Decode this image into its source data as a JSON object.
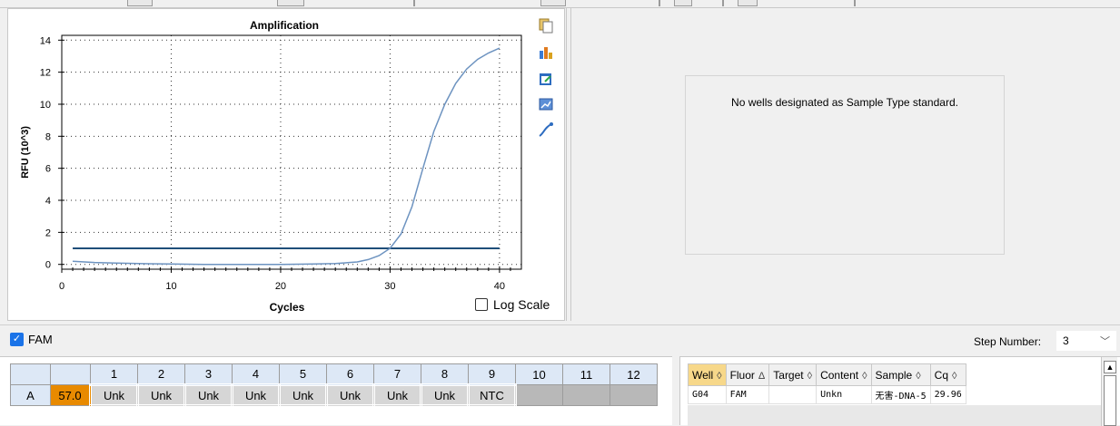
{
  "chart_data": {
    "type": "line",
    "title": "Amplification",
    "xlabel": "Cycles",
    "ylabel": "RFU (10^3)",
    "xlim": [
      0,
      42
    ],
    "ylim": [
      -0.3,
      14.3
    ],
    "xticks": [
      0,
      10,
      20,
      30,
      40
    ],
    "yticks": [
      0,
      2,
      4,
      6,
      8,
      10,
      12,
      14
    ],
    "grid": "dotted",
    "series": [
      {
        "color": "#6d93c0",
        "x": [
          1,
          3,
          5,
          8,
          10,
          13,
          15,
          18,
          20,
          23,
          25,
          27,
          28,
          29,
          30,
          31,
          32,
          33,
          34,
          35,
          36,
          37,
          38,
          39,
          40
        ],
        "y": [
          0.2,
          0.12,
          0.08,
          0.04,
          0.02,
          0.0,
          0.0,
          0.0,
          0.0,
          0.02,
          0.05,
          0.15,
          0.3,
          0.55,
          1.0,
          1.9,
          3.6,
          6.0,
          8.3,
          10.0,
          11.3,
          12.2,
          12.8,
          13.2,
          13.5
        ]
      }
    ],
    "threshold": {
      "y": 1.0,
      "color": "#1f4e79"
    },
    "log_scale_label": "Log Scale",
    "log_scale_checked": false
  },
  "tool_icons": [
    "copy-icon",
    "chart-settings-icon",
    "export-icon",
    "zoom-icon",
    "curve-icon"
  ],
  "standard_curve": {
    "message": "No wells designated as Sample Type standard."
  },
  "fluor": {
    "label": "FAM",
    "checked": true,
    "step_label": "Step Number:",
    "step_value": "3"
  },
  "plate": {
    "columns": [
      "1",
      "2",
      "3",
      "4",
      "5",
      "6",
      "7",
      "8",
      "9",
      "10",
      "11",
      "12"
    ],
    "rows": [
      {
        "label": "A",
        "temp": "57.0",
        "wells": [
          "Unk",
          "Unk",
          "Unk",
          "Unk",
          "Unk",
          "Unk",
          "Unk",
          "Unk",
          "NTC",
          "",
          "",
          ""
        ]
      }
    ]
  },
  "data_table": {
    "headers": [
      {
        "label": "Well",
        "sort": "◊"
      },
      {
        "label": "Fluor",
        "sort": "Δ"
      },
      {
        "label": "Target",
        "sort": "◊"
      },
      {
        "label": "Content",
        "sort": "◊"
      },
      {
        "label": "Sample",
        "sort": "◊"
      },
      {
        "label": "Cq",
        "sort": "◊"
      }
    ],
    "rows": [
      [
        "G04",
        "FAM",
        "",
        "Unkn",
        "无害-DNA-5",
        "29.96"
      ]
    ]
  }
}
